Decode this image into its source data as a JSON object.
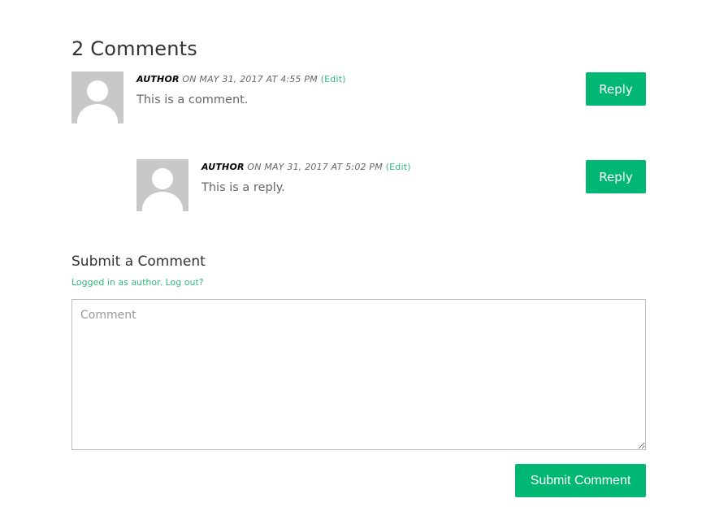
{
  "comments_section": {
    "title": "2 Comments",
    "comments": [
      {
        "author": "AUTHOR",
        "date": "ON MAY 31, 2017 AT 4:55 PM",
        "edit_label": "(Edit)",
        "text": "This is a comment.",
        "reply_label": "Reply",
        "avatar_icon": "default-avatar-icon"
      },
      {
        "author": "AUTHOR",
        "date": "ON MAY 31, 2017 AT 5:02 PM",
        "edit_label": "(Edit)",
        "text": "This is a reply.",
        "reply_label": "Reply",
        "avatar_icon": "default-avatar-icon"
      }
    ]
  },
  "respond": {
    "title": "Submit a Comment",
    "logged_in_prefix": "Logged in as author.",
    "logout_label": "Log out?",
    "comment_placeholder": "Comment",
    "comment_value": "",
    "submit_label": "Submit Comment"
  },
  "colors": {
    "accent": "#00b874",
    "link": "#2ebc7c",
    "avatar_bg": "#c8c8c8",
    "text": "#666666",
    "heading": "#333333"
  }
}
